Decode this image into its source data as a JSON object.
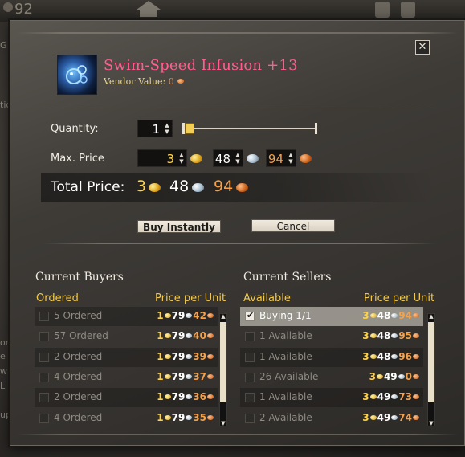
{
  "background": {
    "currency_count": "92",
    "edge_letters": [
      "G",
      "tio",
      "or",
      "e",
      "w",
      "L",
      "up"
    ]
  },
  "window": {
    "close_label": "✕",
    "item": {
      "name": "Swim-Speed Infusion +13",
      "name_color": "#ff5f8e",
      "vendor_label": "Vendor Value:",
      "vendor_value": "0",
      "icon": "infusion-orb-icon"
    },
    "form": {
      "quantity_label": "Quantity:",
      "quantity_value": "1",
      "quantity_slider_fraction": 0.0,
      "max_price_label": "Max. Price",
      "max_price": {
        "gold": "3",
        "silver": "48",
        "copper": "94"
      }
    },
    "total": {
      "label": "Total Price:",
      "gold": "3",
      "silver": "48",
      "copper": "94"
    },
    "buttons": {
      "buy_instantly": "Buy Instantly",
      "cancel": "Cancel"
    },
    "buyers": {
      "title": "Current Buyers",
      "col_left": "Ordered",
      "col_right": "Price per Unit",
      "rows": [
        {
          "label": "5 Ordered",
          "g": "1",
          "s": "79",
          "c": "42"
        },
        {
          "label": "57 Ordered",
          "g": "1",
          "s": "79",
          "c": "40"
        },
        {
          "label": "2 Ordered",
          "g": "1",
          "s": "79",
          "c": "39"
        },
        {
          "label": "4 Ordered",
          "g": "1",
          "s": "79",
          "c": "37"
        },
        {
          "label": "2 Ordered",
          "g": "1",
          "s": "79",
          "c": "36"
        },
        {
          "label": "4 Ordered",
          "g": "1",
          "s": "79",
          "c": "35"
        }
      ]
    },
    "sellers": {
      "title": "Current Sellers",
      "col_left": "Available",
      "col_right": "Price per Unit",
      "rows": [
        {
          "label": "Buying 1/1",
          "g": "3",
          "s": "48",
          "c": "94",
          "selected": true
        },
        {
          "label": "1 Available",
          "g": "3",
          "s": "48",
          "c": "95"
        },
        {
          "label": "1 Available",
          "g": "3",
          "s": "48",
          "c": "96"
        },
        {
          "label": "26 Available",
          "g": "3",
          "s": "49",
          "c": "0"
        },
        {
          "label": "1 Available",
          "g": "3",
          "s": "49",
          "c": "73"
        },
        {
          "label": "2 Available",
          "g": "3",
          "s": "49",
          "c": "74"
        }
      ]
    },
    "colors": {
      "gold": "#ffd24a",
      "silver": "#ffffff",
      "copper": "#f4a24c",
      "header_yellow": "#f2c94c"
    }
  }
}
